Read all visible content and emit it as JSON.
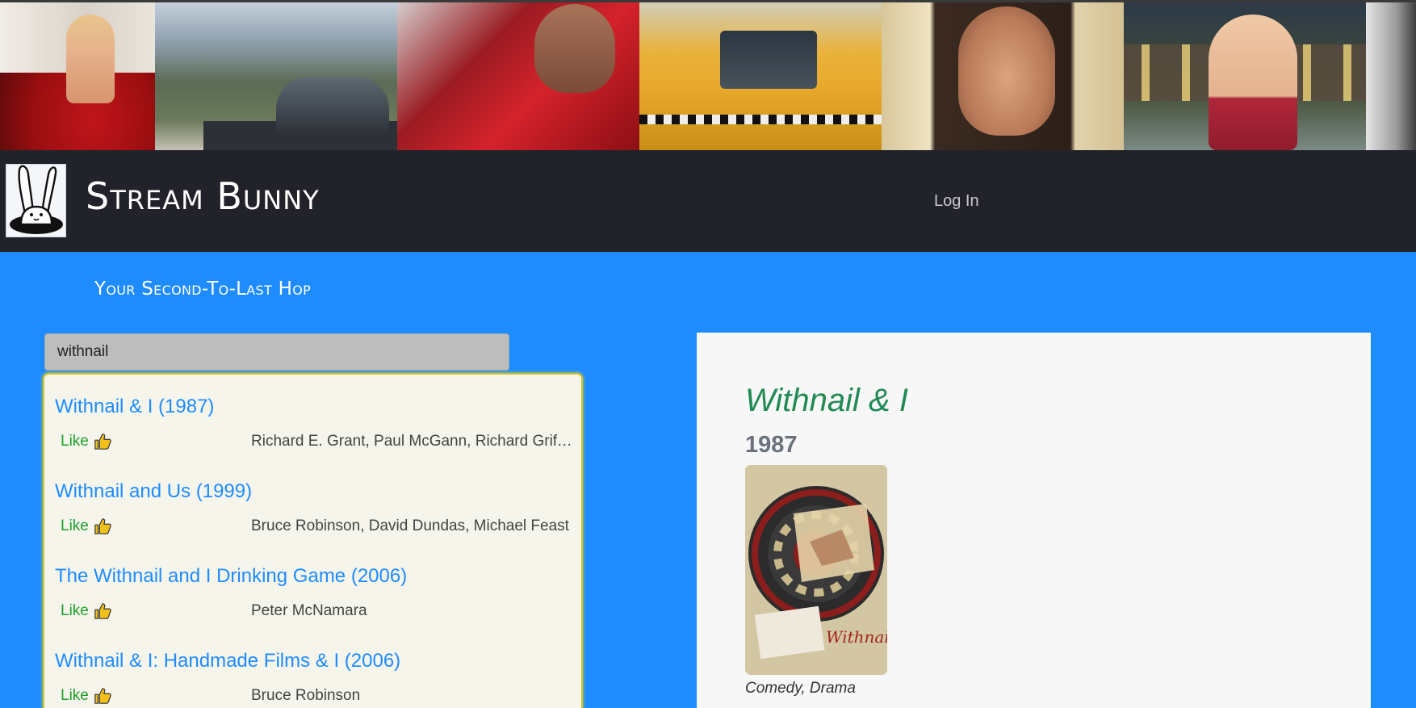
{
  "header": {
    "site_title": "Stream Bunny",
    "login_label": "Log In",
    "logo_icon": "bunny-logo-icon",
    "banner_icons": [
      "banner-still-1",
      "banner-still-2",
      "banner-still-3",
      "banner-still-4",
      "banner-still-5",
      "banner-still-6",
      "banner-still-7"
    ]
  },
  "tagline": "Your Second-To-Last Hop",
  "search": {
    "value": "withnail"
  },
  "results": [
    {
      "title": "Withnail & I (1987)",
      "like_label": "Like",
      "like_icon": "thumbs-up-icon",
      "cast": "Richard E. Grant, Paul McGann, Richard Griffiths"
    },
    {
      "title": "Withnail and Us (1999)",
      "like_label": "Like",
      "like_icon": "thumbs-up-icon",
      "cast": "Bruce Robinson, David Dundas, Michael Feast"
    },
    {
      "title": "The Withnail and I Drinking Game (2006)",
      "like_label": "Like",
      "like_icon": "thumbs-up-icon",
      "cast": "Peter McNamara"
    },
    {
      "title": "Withnail & I: Handmade Films & I (2006)",
      "like_label": "Like",
      "like_icon": "thumbs-up-icon",
      "cast": "Bruce Robinson"
    }
  ],
  "detail": {
    "title": "Withnail & I",
    "year": "1987",
    "poster_icon": "movie-poster-image",
    "genres": "Comedy, Drama"
  },
  "colors": {
    "page_background": "#1e8cff",
    "navbar": "#22222b",
    "link": "#1e8cff",
    "like": "#1e9e2a",
    "detail_title": "#218a55",
    "results_border": "#d2c61e"
  }
}
